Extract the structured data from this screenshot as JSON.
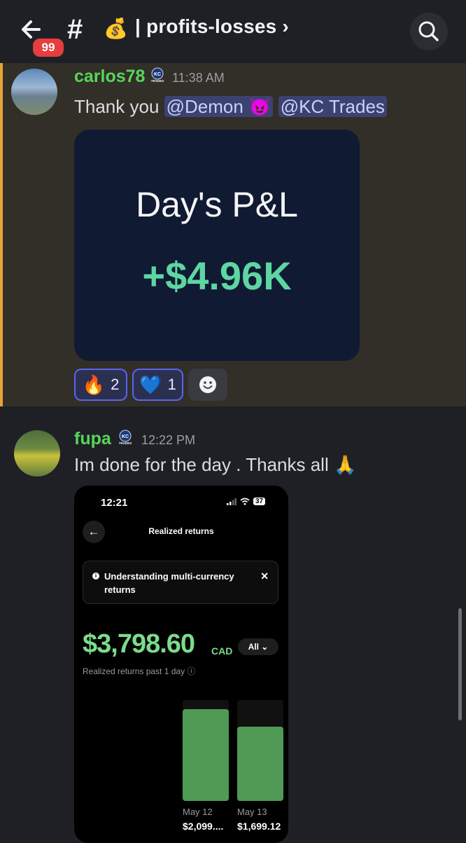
{
  "header": {
    "badge_count": "99",
    "channel_emoji": "💰",
    "channel_name": "| profits-losses ›"
  },
  "messages": [
    {
      "username": "carlos78",
      "badge_text": "KC",
      "badge_sub": "TRADES",
      "time": "11:38 AM",
      "text_before": "Thank you ",
      "mentions": [
        "@Demon 😈",
        "@KC Trades"
      ],
      "attachment": {
        "title": "Day's P&L",
        "value": "+$4.96K"
      },
      "reactions": [
        {
          "emoji": "🔥",
          "count": "2"
        },
        {
          "emoji": "💙",
          "count": "1"
        }
      ]
    },
    {
      "username": "fupa",
      "badge_text": "KC",
      "badge_sub": "TRADES",
      "time": "12:22 PM",
      "text": "Im done for the day . Thanks all 🙏",
      "attachment": {
        "status_time": "12:21",
        "battery": "37",
        "screen_title": "Realized returns",
        "banner_text": "Understanding multi-currency returns",
        "amount": "$3,798.60",
        "currency": "CAD",
        "filter": "All ⌄",
        "subtitle": "Realized returns past 1 day ⓘ"
      }
    }
  ],
  "chart_data": {
    "type": "bar",
    "categories": [
      "May 12",
      "May 13"
    ],
    "value_labels": [
      "$2,099....",
      "$1,699.12"
    ],
    "values": [
      2099,
      1699.12
    ],
    "ylim": [
      0,
      2300
    ],
    "colors": {
      "bar": "#4f9a55"
    }
  }
}
